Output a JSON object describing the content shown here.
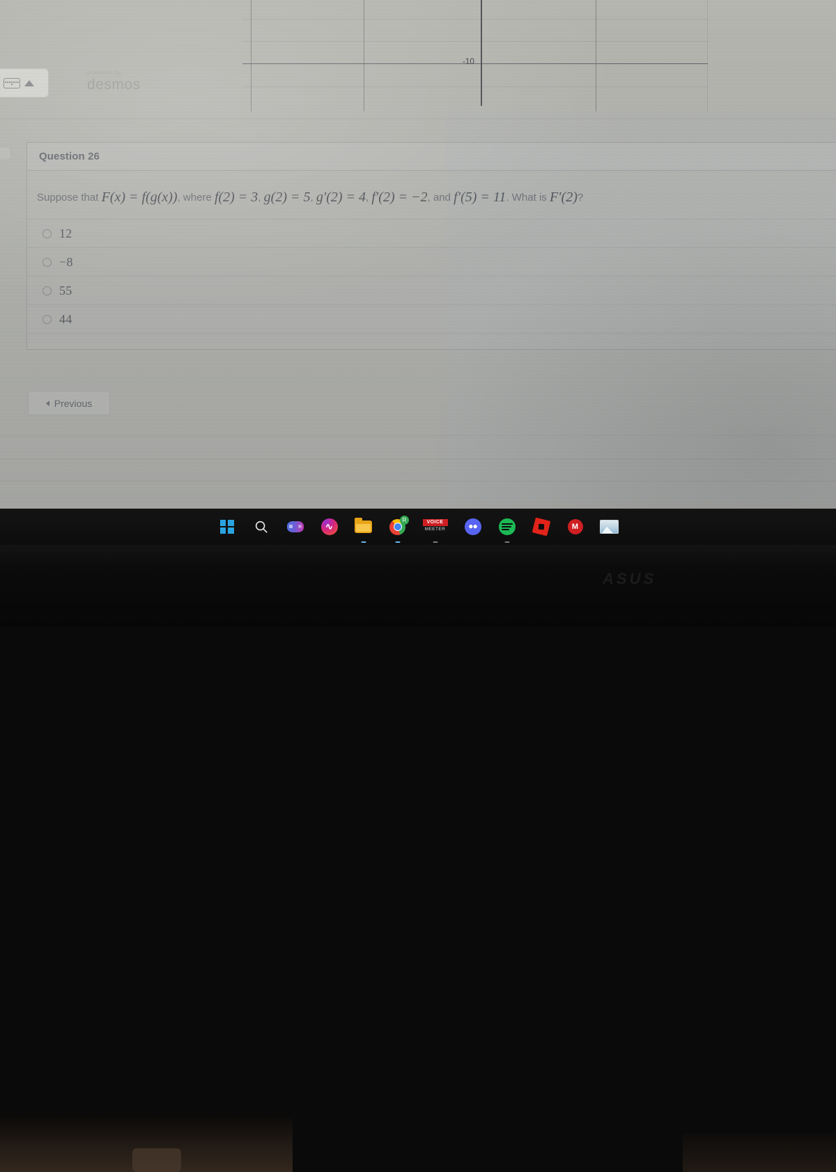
{
  "graph": {
    "tick_label": "-10",
    "brand_powered": "powered by",
    "brand_name": "desmos",
    "keyboard_icon": "keyboard-icon",
    "collapse_icon": "triangle-up-icon"
  },
  "quiz": {
    "header": "Question 26",
    "question": {
      "lead": "Suppose that",
      "expr_F": "F(x) = f(g(x))",
      "where": ", where",
      "expr_f2": "f(2) = 3",
      "sep1": ",",
      "expr_g2": "g(2) = 5",
      "sep2": ",",
      "expr_gp2": "g′(2) = 4",
      "sep3": ",",
      "expr_fp2": "f′(2) = −2",
      "and": ", and",
      "expr_fp5": "f′(5) = 11",
      "tail": ". What is",
      "expr_ask": "F′(2)",
      "qmark": "?"
    },
    "options": [
      {
        "label": "12",
        "selected": false
      },
      {
        "label": "−8",
        "selected": false
      },
      {
        "label": "55",
        "selected": false
      },
      {
        "label": "44",
        "selected": false
      }
    ],
    "previous_button": "Previous"
  },
  "taskbar": {
    "items": [
      {
        "name": "start-icon",
        "label": "Start"
      },
      {
        "name": "search-icon",
        "label": "Search"
      },
      {
        "name": "game-controller-icon",
        "label": "Xbox Game Bar"
      },
      {
        "name": "messenger-icon",
        "label": "Messenger"
      },
      {
        "name": "file-explorer-icon",
        "label": "File Explorer"
      },
      {
        "name": "chrome-icon",
        "label": "Google Chrome",
        "badge": "R"
      },
      {
        "name": "voicemeeter-icon",
        "label_top": "VOICE",
        "label_bottom": "MEETER"
      },
      {
        "name": "discord-icon",
        "label": "Discord"
      },
      {
        "name": "spotify-icon",
        "label": "Spotify"
      },
      {
        "name": "roblox-icon",
        "label": "Roblox"
      },
      {
        "name": "red-app-icon",
        "label": "M"
      },
      {
        "name": "photo-thumbnail-icon",
        "label": "Photo"
      }
    ]
  },
  "device": {
    "brand": "ASUS"
  },
  "colors": {
    "screen_bg": "#b2b3ae",
    "text_muted": "#6b6e73",
    "taskbar_bg": "#101010",
    "accent_blue": "#2aa4e0"
  }
}
